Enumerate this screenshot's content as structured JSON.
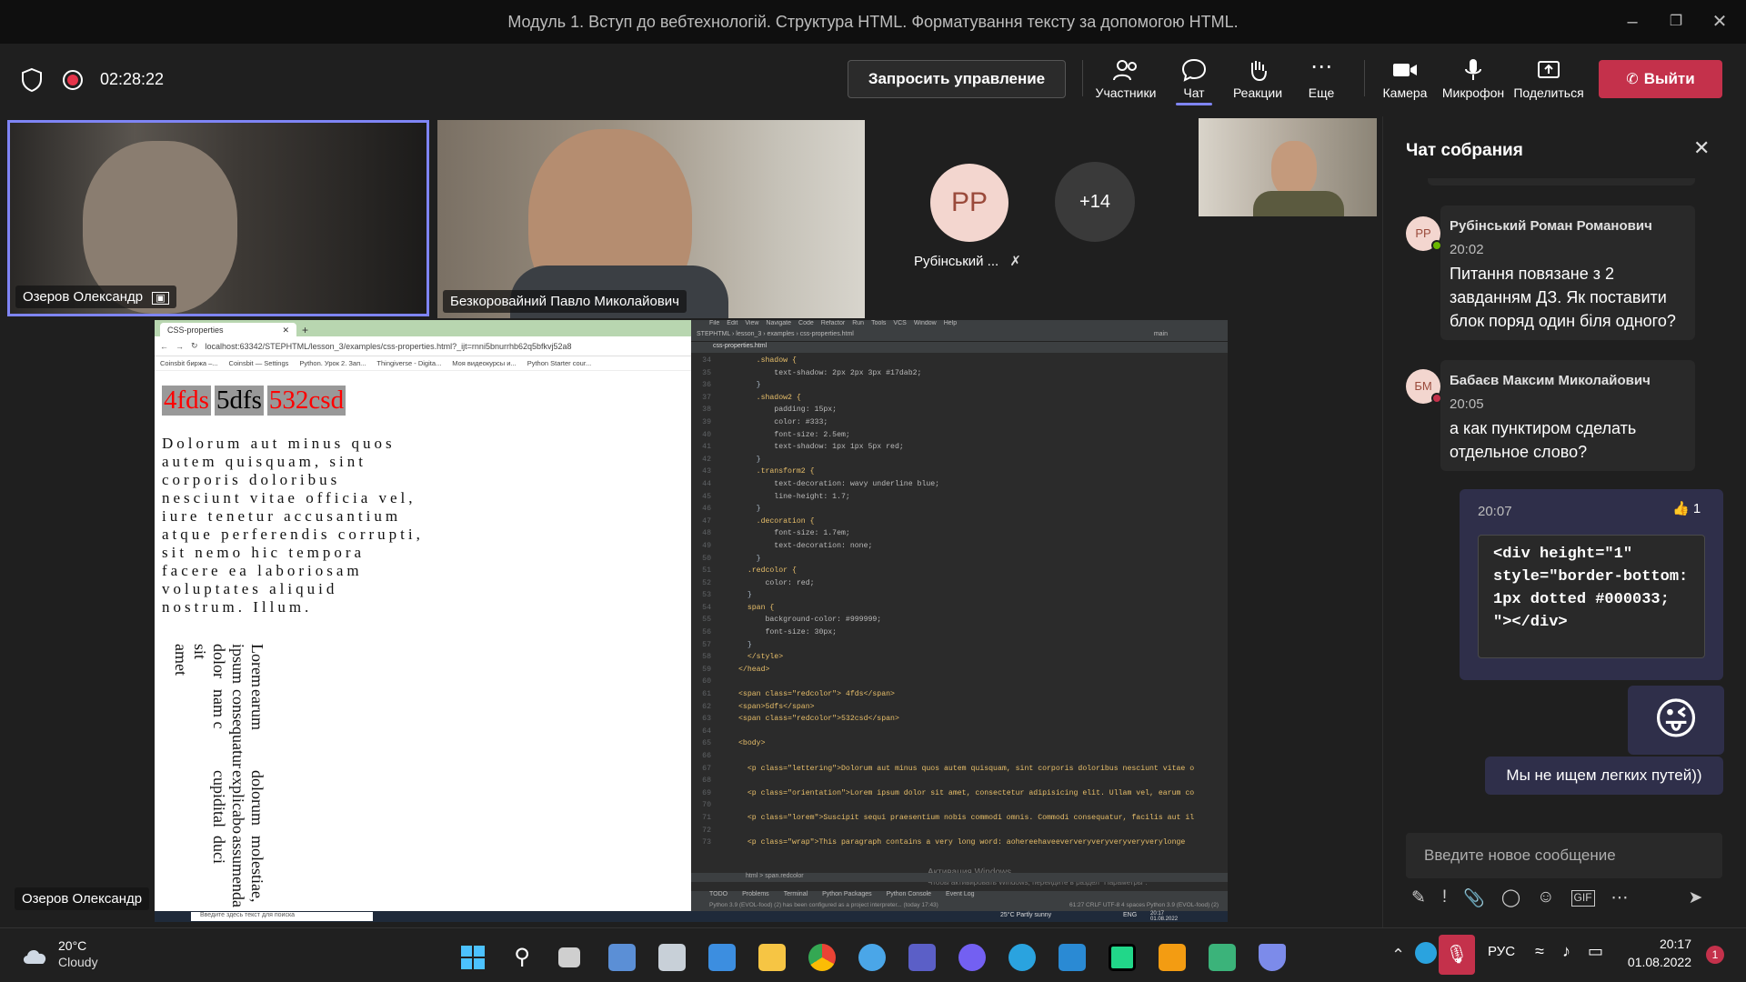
{
  "window": {
    "title": "Модуль 1. Вступ до вебтехнологій. Структура HTML. Форматування тексту за допомогою HTML."
  },
  "meeting": {
    "timer": "02:28:22",
    "request_control": "Запросить управление",
    "buttons": {
      "participants": "Участники",
      "chat": "Чат",
      "reactions": "Реакции",
      "more": "Еще",
      "camera": "Камера",
      "mic": "Микрофон",
      "share": "Поделиться",
      "leave": "Выйти"
    }
  },
  "participants": {
    "tile1_name": "Озеров Олександр",
    "tile2_name": "Безкоровайний Павло Миколайович",
    "avatar_initials": "PP",
    "avatar_name": "Рубінський ...",
    "more_count": "+14",
    "share_presenter": "Озеров Олександр"
  },
  "shared": {
    "browser_tab": "CSS-properties",
    "url": "localhost:63342/STEPHTML/lesson_3/examples/css-properties.html?_ijt=rnni5bnurrhb62q5bfkvj52a8",
    "bookmarks": [
      "Coinsbit биржа –...",
      "Coinsbit — Settings",
      "Python. Урок 2. Зап...",
      "Thingiverse - Digita...",
      "Моя видеокурсы и...",
      "Python Starter cour..."
    ],
    "spans": [
      "4fds",
      "5dfs",
      "532csd"
    ],
    "lettering": "Dolorum aut minus quos autem quisquam, sint corporis doloribus nesciunt vitae officia vel, iure tenetur accusantium atque perferendis corrupti, sit nemo hic tempora facere ea laboriosam voluptates aliquid nostrum. Illum.",
    "vertical": [
      "molestiae, assumenda duci",
      "dolorum explicabo cupidital",
      "earum consequatur nam c",
      "Lorem ipsum dolor sit amet"
    ],
    "ide_menu": [
      "File",
      "Edit",
      "View",
      "Navigate",
      "Code",
      "Refactor",
      "Run",
      "Tools",
      "VCS",
      "Window",
      "Help"
    ],
    "ide_project": "STEPHTML",
    "ide_file": "css-properties.html",
    "ide_branch": "main",
    "code_lines": [
      "    .shadow {",
      "        text-shadow: 2px 2px 3px #17dab2;",
      "    }",
      "    .shadow2 {",
      "        padding: 15px;",
      "        color: #333;",
      "        font-size: 2.5em;",
      "        text-shadow: 1px 1px 5px red;",
      "    }",
      "    .transform2 {",
      "        text-decoration: wavy underline blue;",
      "        line-height: 1.7;",
      "    }",
      "    .decoration {",
      "        font-size: 1.7em;",
      "        text-decoration: none;",
      "    }",
      "  .redcolor {",
      "      color: red;",
      "  }",
      "  span {",
      "      background-color: #999999;",
      "      font-size: 30px;",
      "  }",
      "  </style>",
      "</head>",
      "",
      "<span class=\"redcolor\"> 4fds</span>",
      "<span>5dfs</span>",
      "<span class=\"redcolor\">532csd</span>",
      "",
      "<body>",
      "",
      "  <p class=\"lettering\">Dolorum aut minus quos autem quisquam, sint corporis doloribus nesciunt vitae o",
      "",
      "  <p class=\"orientation\">Lorem ipsum dolor sit amet, consectetur adipisicing elit. Ullam vel, earum co",
      "",
      "  <p class=\"lorem\">Suscipit sequi praesentium nobis commodi omnis. Commodi consequatur, facilis aut il",
      "",
      "  <p class=\"wrap\">This paragraph contains a very long word: aohereehaveeververyveryveryveryverylonge"
    ],
    "line_numbers": [
      "34",
      "35",
      "36",
      "37",
      "38",
      "39",
      "40",
      "41",
      "42",
      "43",
      "44",
      "45",
      "46",
      "47",
      "48",
      "49",
      "50",
      "51",
      "52",
      "53",
      "54",
      "55",
      "56",
      "57",
      "58",
      "59",
      "60",
      "61",
      "62",
      "63",
      "64",
      "65",
      "66",
      "67",
      "68",
      "69",
      "70",
      "71",
      "72",
      "73"
    ],
    "activation_title": "Активация Windows",
    "activation_sub": "Чтобы активировать Windows, перейдите в раздел \"Параметры\".",
    "ide_bottom_tabs": [
      "TODO",
      "Problems",
      "Terminal",
      "Python Packages",
      "Python Console",
      "Event Log"
    ],
    "ide_status": "Python 3.9 (EVOL-food) (2) has been configured as a project interpreter... (today 17:43)",
    "ide_status_right": "61:27  CRLF  UTF-8  4 spaces  Python 3.9 (EVOL-food) (2)",
    "breadcrumb": "html  >  span.redcolor",
    "inner_search": "Введите здесь текст для поиска",
    "inner_weather": "25°C  Partly sunny",
    "inner_lang": "ENG",
    "inner_time": "20:17",
    "inner_date": "01.08.2022"
  },
  "chat": {
    "title": "Чат собрания",
    "messages": [
      {
        "initials": "PP",
        "sender": "Рубінський Роман Романович",
        "time": "20:02",
        "text": "Питання повязане з 2 завданням ДЗ. Як поставити блок поряд один біля одного?"
      },
      {
        "initials": "БМ",
        "sender": "Бабаєв Максим Миколайович",
        "time": "20:05",
        "text": "а как пунктиром сделать отдельное слово?"
      }
    ],
    "own_time": "20:07",
    "own_reaction_count": "1",
    "own_code": "<div height=\"1\" style=\"border-bottom: 1px dotted #000033; \"></div>",
    "last_message": "Мы не ищем легких путей))",
    "input_placeholder": "Введите новое сообщение"
  },
  "taskbar": {
    "temp": "20°C",
    "weather": "Cloudy",
    "lang": "РУС",
    "time": "20:17",
    "date": "01.08.2022",
    "notif": "1"
  }
}
